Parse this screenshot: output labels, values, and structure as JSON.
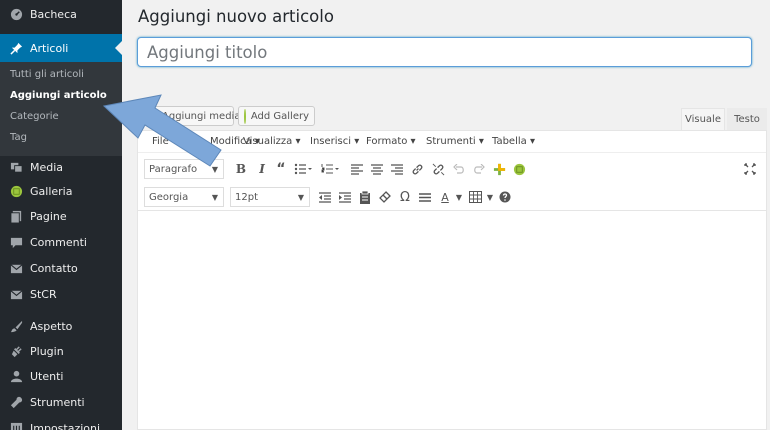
{
  "sidebar": {
    "top": {
      "label": "Bacheca",
      "icon": "dashboard-icon"
    },
    "active": {
      "label": "Articoli",
      "icon": "pin-icon"
    },
    "submenu": [
      {
        "label": "Tutti gli articoli",
        "current": false
      },
      {
        "label": "Aggiungi articolo",
        "current": true
      },
      {
        "label": "Categorie",
        "current": false
      },
      {
        "label": "Tag",
        "current": false
      }
    ],
    "items": [
      {
        "label": "Media",
        "icon": "media-icon"
      },
      {
        "label": "Galleria",
        "icon": "gallery-icon"
      },
      {
        "label": "Pagine",
        "icon": "pages-icon"
      },
      {
        "label": "Commenti",
        "icon": "comments-icon"
      },
      {
        "label": "Contatto",
        "icon": "mail-icon"
      },
      {
        "label": "StCR",
        "icon": "mail-icon"
      },
      {
        "label": "Aspetto",
        "icon": "brush-icon"
      },
      {
        "label": "Plugin",
        "icon": "plug-icon"
      },
      {
        "label": "Utenti",
        "icon": "user-icon"
      },
      {
        "label": "Strumenti",
        "icon": "wrench-icon"
      },
      {
        "label": "Impostazioni",
        "icon": "settings-icon"
      }
    ]
  },
  "main": {
    "page_title": "Aggiungi nuovo articolo",
    "title_placeholder": "Aggiungi titolo",
    "add_media": "Aggiungi media",
    "add_gallery": "Add Gallery",
    "tab_visual": "Visuale",
    "tab_text": "Testo"
  },
  "editor": {
    "menubar": [
      "File",
      "Modifica",
      "Visualizza",
      "Inserisci",
      "Formato",
      "Strumenti",
      "Tabella"
    ],
    "format_select": "Paragrafo",
    "font_select": "Georgia",
    "size_select": "12pt",
    "bold": "B",
    "italic": "I",
    "quote": "“",
    "text_color": "A",
    "omega": "Ω"
  },
  "colors": {
    "sidebar_bg": "#23282d",
    "submenu_bg": "#32373c",
    "accent": "#0073aa",
    "arrow": "#7da7d9",
    "gallery_green": "#9bc53d"
  }
}
